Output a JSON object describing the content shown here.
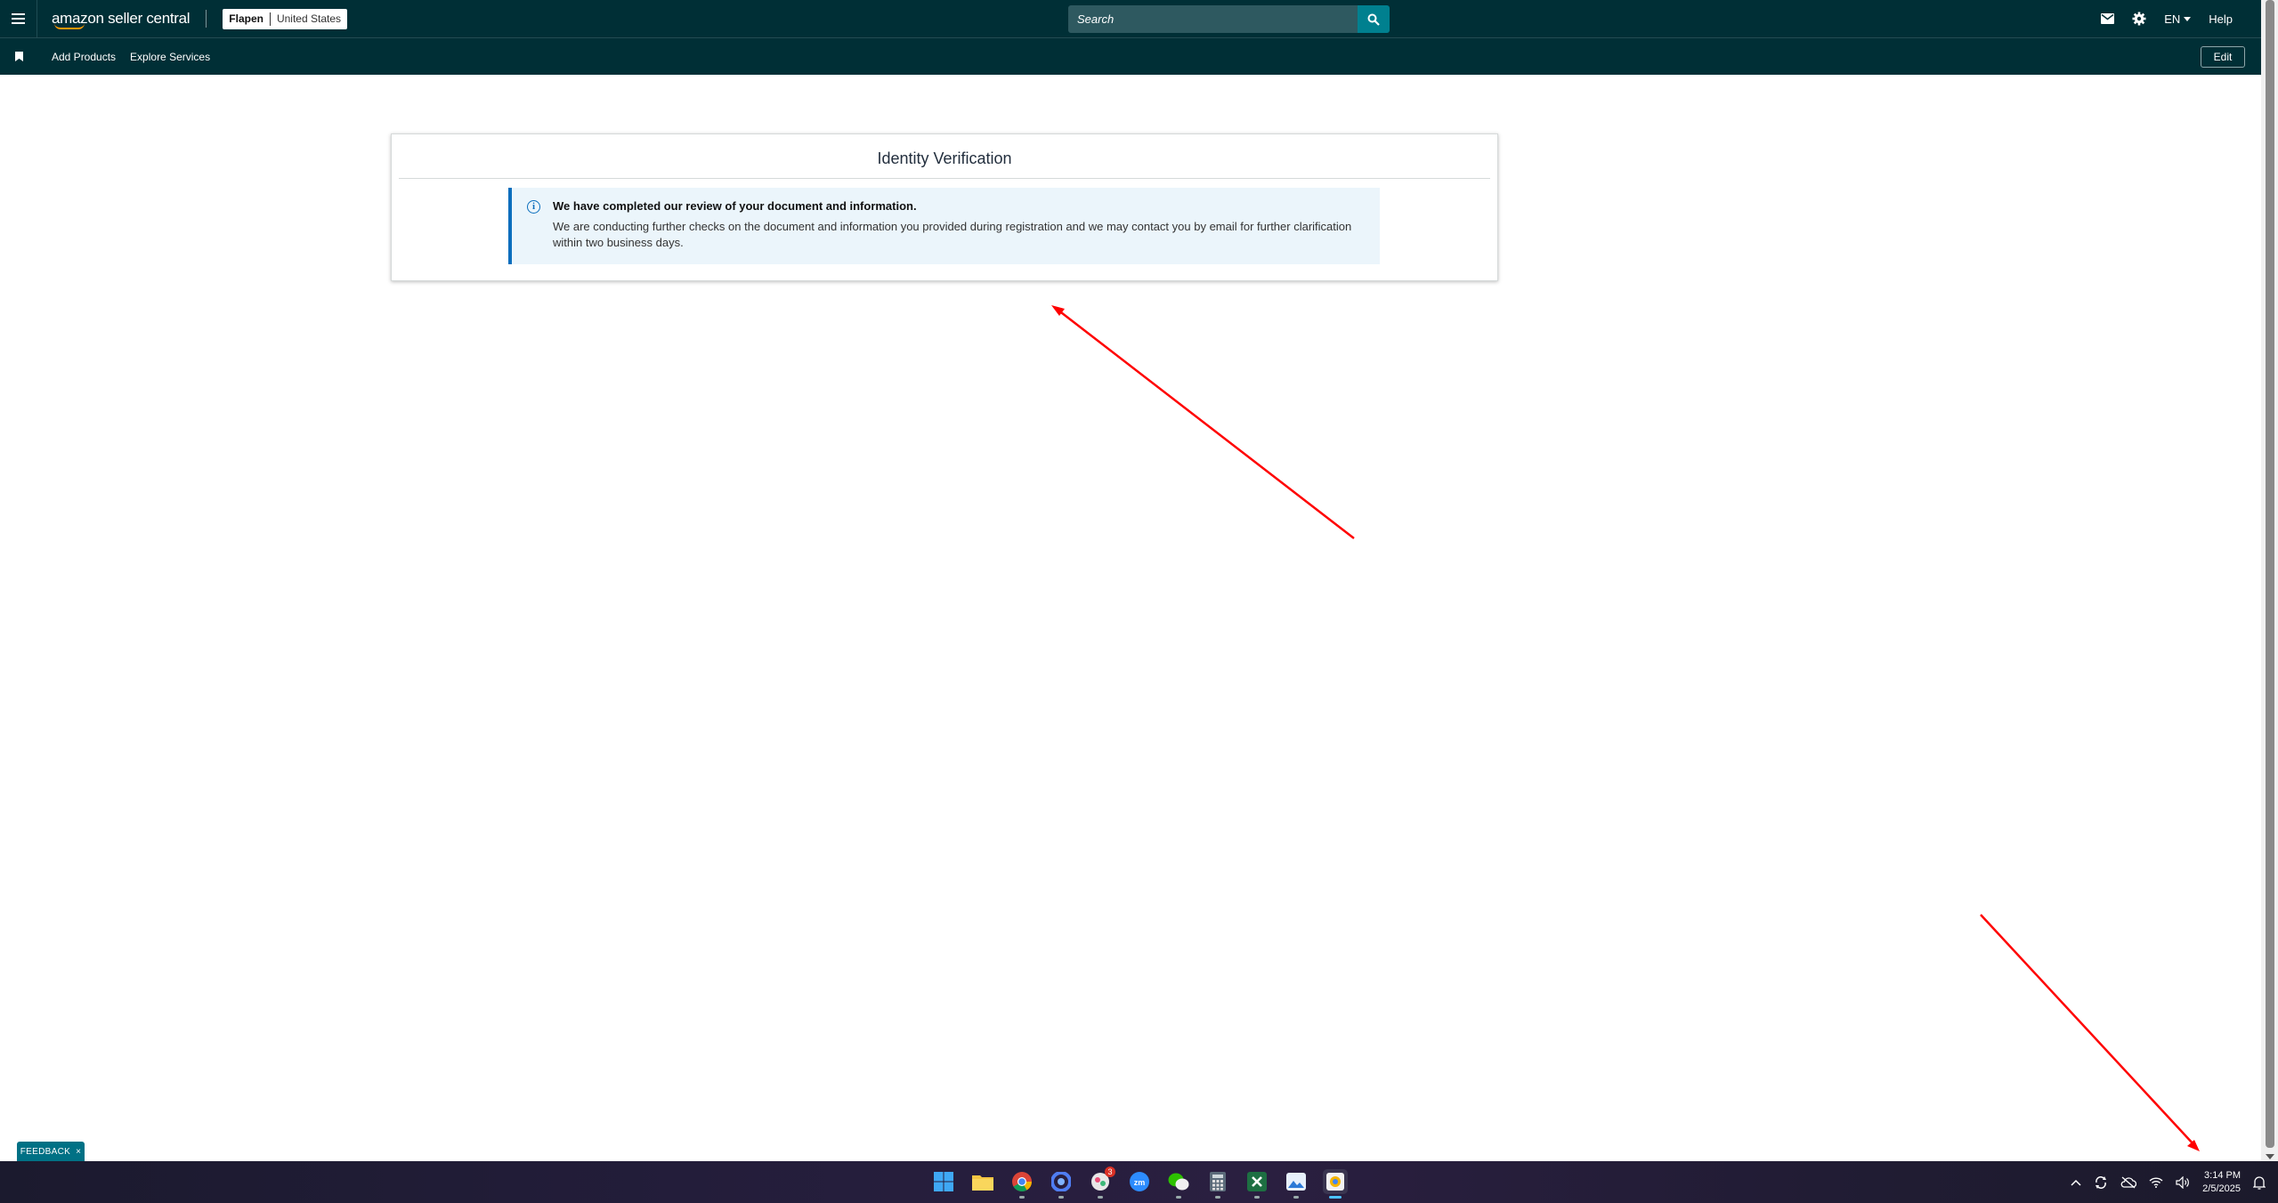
{
  "header": {
    "logo_text": "amazon seller central",
    "account_name": "Flapen",
    "marketplace": "United States",
    "search_placeholder": "Search",
    "language": "EN",
    "help_label": "Help"
  },
  "nav": {
    "links": [
      "Add Products",
      "Explore Services"
    ],
    "edit_label": "Edit"
  },
  "card": {
    "title": "Identity Verification",
    "alert_heading": "We have completed our review of your document and information.",
    "alert_body": "We are conducting further checks on the document and information you provided during registration and we may contact you by email for further clarification within two business days."
  },
  "feedback": {
    "label": "FEEDBACK",
    "close_glyph": "×"
  },
  "taskbar": {
    "time": "3:14 PM",
    "date": "2/5/2025",
    "notification_badge": "3"
  },
  "colors": {
    "header_bg": "#002f36",
    "search_button": "#00808f",
    "alert_bg": "#ebf5fb",
    "alert_accent": "#0a6ebd",
    "annotation_arrow": "#ff0000"
  }
}
